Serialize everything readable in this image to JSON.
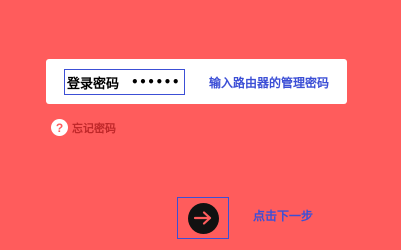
{
  "login": {
    "password_label": "登录密码",
    "password_value": "••••••",
    "hint": "输入路由器的管理密码"
  },
  "forgot": {
    "icon_glyph": "?",
    "label": "忘记密码"
  },
  "next": {
    "icon": "arrow-right-icon",
    "label": "点击下一步"
  },
  "colors": {
    "background": "#ff5c5c",
    "accent": "#3c4fd6",
    "forgot_text": "#c0282a"
  }
}
